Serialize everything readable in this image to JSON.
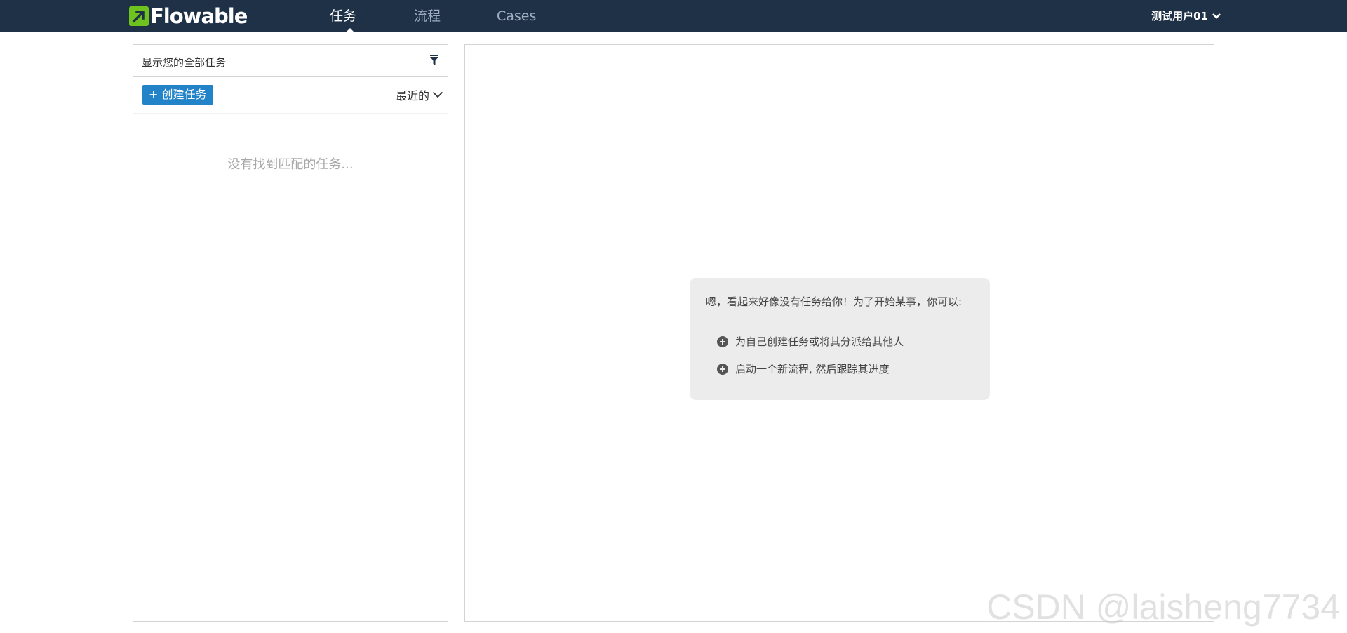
{
  "app": {
    "logo_text_flow": "Flow",
    "logo_text_able": "able",
    "brand_color": "#6ec31f",
    "navbar_color": "#1f3147"
  },
  "nav": {
    "tabs": [
      {
        "label": "任务",
        "active": true
      },
      {
        "label": "流程",
        "active": false
      },
      {
        "label": "Cases",
        "active": false
      }
    ],
    "user_label": "测试用户01",
    "user_icon": "chevron-down-icon"
  },
  "task_list": {
    "filter_label": "显示您的全部任务",
    "filter_icon": "filter-icon",
    "create_button": "+ 创建任务",
    "sort_label": "最近的",
    "empty_message": "没有找到匹配的任务...",
    "accent_color": "#2283c8"
  },
  "detail": {
    "intro": "嗯，看起来好像没有任务给你！为了开始某事，你可以:",
    "actions": [
      {
        "label": "为自己创建任务或将其分派给其他人",
        "icon": "plus-circle-icon"
      },
      {
        "label": "启动一个新流程, 然后跟踪其进度",
        "icon": "plus-circle-icon"
      }
    ]
  },
  "watermark": "CSDN @laisheng7734"
}
